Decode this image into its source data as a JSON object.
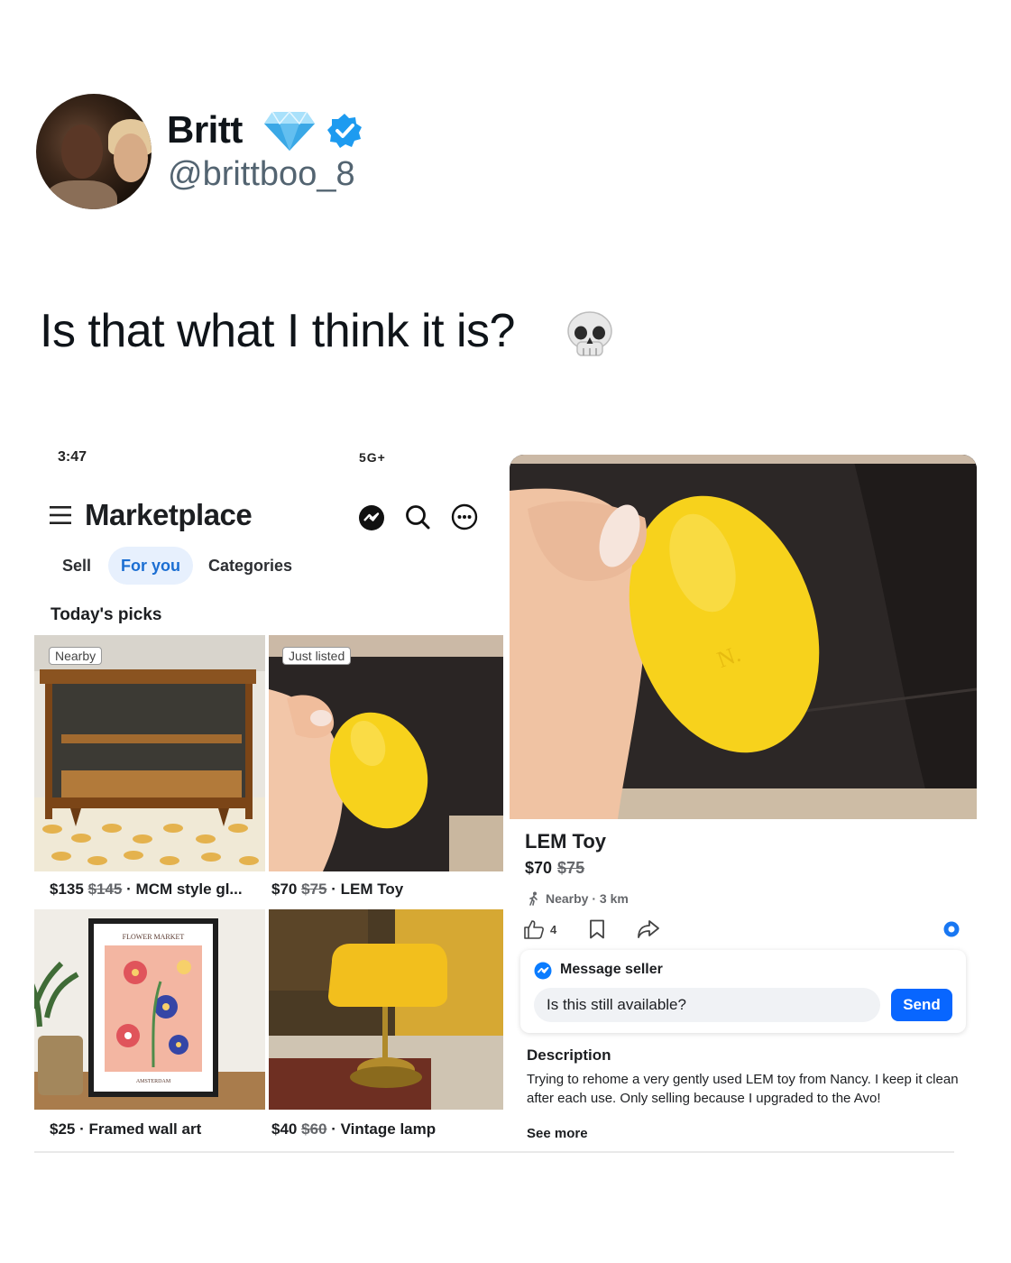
{
  "tweet": {
    "display_name": "Britt",
    "handle": "@brittboo_8",
    "text": "Is that what I think it is?",
    "icons": {
      "badge_1": "gem-icon",
      "badge_2": "verified-icon",
      "emoji": "skull-icon"
    },
    "colors": {
      "verified": "#1d9bf0",
      "text": "#0f1419",
      "handle": "#536471"
    }
  },
  "phone_status": {
    "time": "3:47",
    "signal": "5G+"
  },
  "marketplace": {
    "title": "Marketplace",
    "tabs": [
      {
        "label": "Sell"
      },
      {
        "label": "For you"
      },
      {
        "label": "Categories"
      }
    ],
    "section_title": "Today's picks",
    "listings": [
      {
        "badge": "Nearby",
        "price": "$135",
        "old_price": "$145",
        "name": "MCM style gl..."
      },
      {
        "badge": "Just listed",
        "price": "$70",
        "old_price": "$75",
        "name": "LEM Toy"
      },
      {
        "price": "$25",
        "name": "Framed wall art",
        "poster_text_top": "FLOWER MARKET",
        "poster_text_bottom": "AMSTERDAM"
      },
      {
        "price": "$40",
        "old_price": "$60",
        "name": "Vintage lamp"
      }
    ],
    "accent_color": "#1b6ed2"
  },
  "detail": {
    "title": "LEM Toy",
    "price": "$70",
    "old_price": "$75",
    "location": "Nearby · 3 km",
    "likes": "4",
    "message": {
      "title": "Message seller",
      "input_value": "Is this still available?",
      "send_label": "Send"
    },
    "description_title": "Description",
    "description": "Trying to rehome a very gently used LEM toy from Nancy. I keep it clean after each use. Only selling because I upgraded to the Avo!",
    "see_more": "See more",
    "send_color": "#0866ff"
  }
}
